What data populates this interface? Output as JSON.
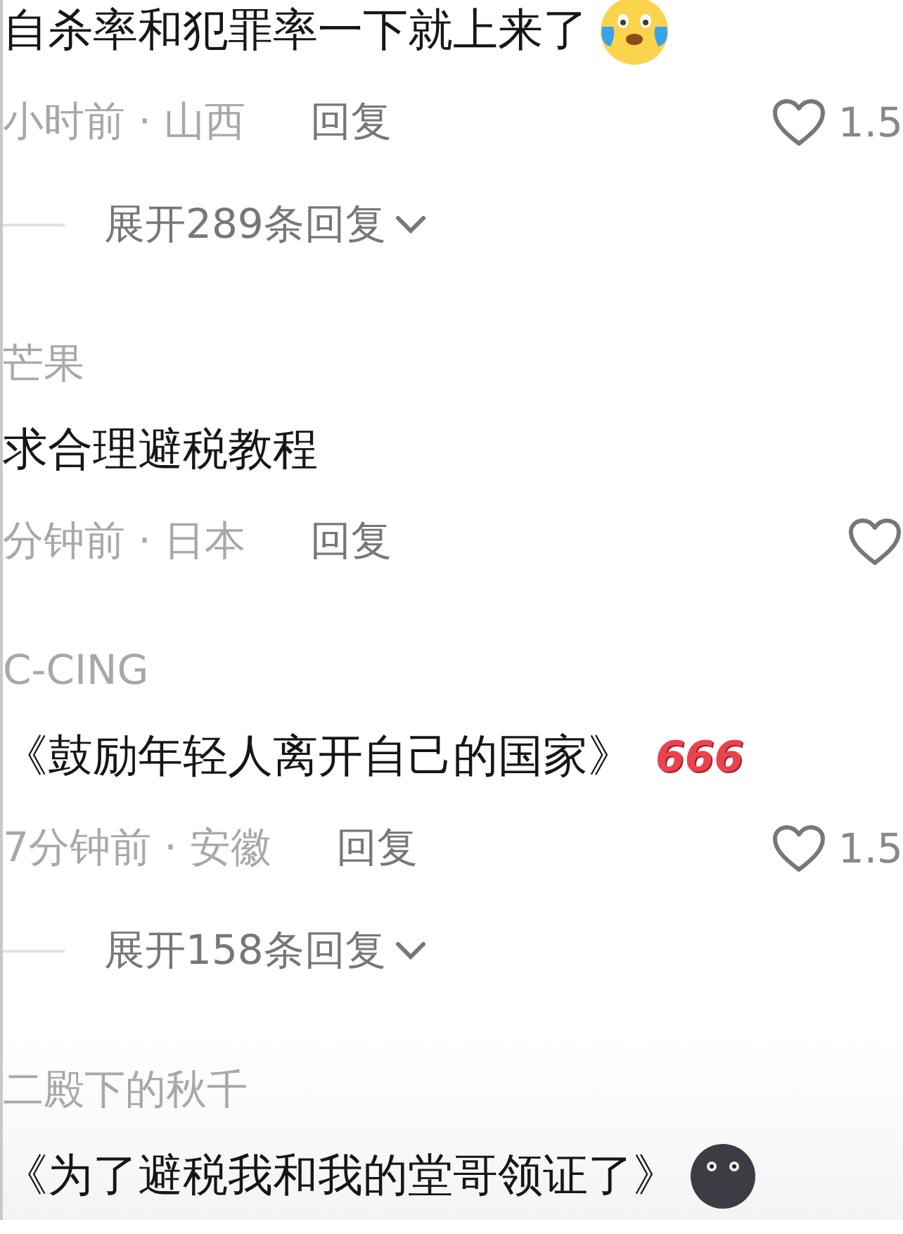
{
  "comments": [
    {
      "text": "自杀率和犯罪率一下就上来了",
      "emoji": {
        "kind": "tears"
      },
      "meta": "小时前 · 山西",
      "reply": "回复",
      "liked": false,
      "likes": "1.5",
      "expand": "展开289条回复"
    },
    {
      "author": "芒果",
      "text": "求合理避税教程",
      "meta": "分钟前 · 日本",
      "reply": "回复",
      "liked": false
    },
    {
      "author": "C-CING",
      "text": "《鼓励年轻人离开自己的国家》",
      "sticker_text": "666",
      "meta": "7分钟前 · 安徽",
      "reply": "回复",
      "liked": false,
      "likes": "1.5",
      "expand": "展开158条回复"
    },
    {
      "author": "二殿下的秋千",
      "text": "《为了避税我和我的堂哥领证了》",
      "emoji": {
        "kind": "moon"
      }
    }
  ]
}
